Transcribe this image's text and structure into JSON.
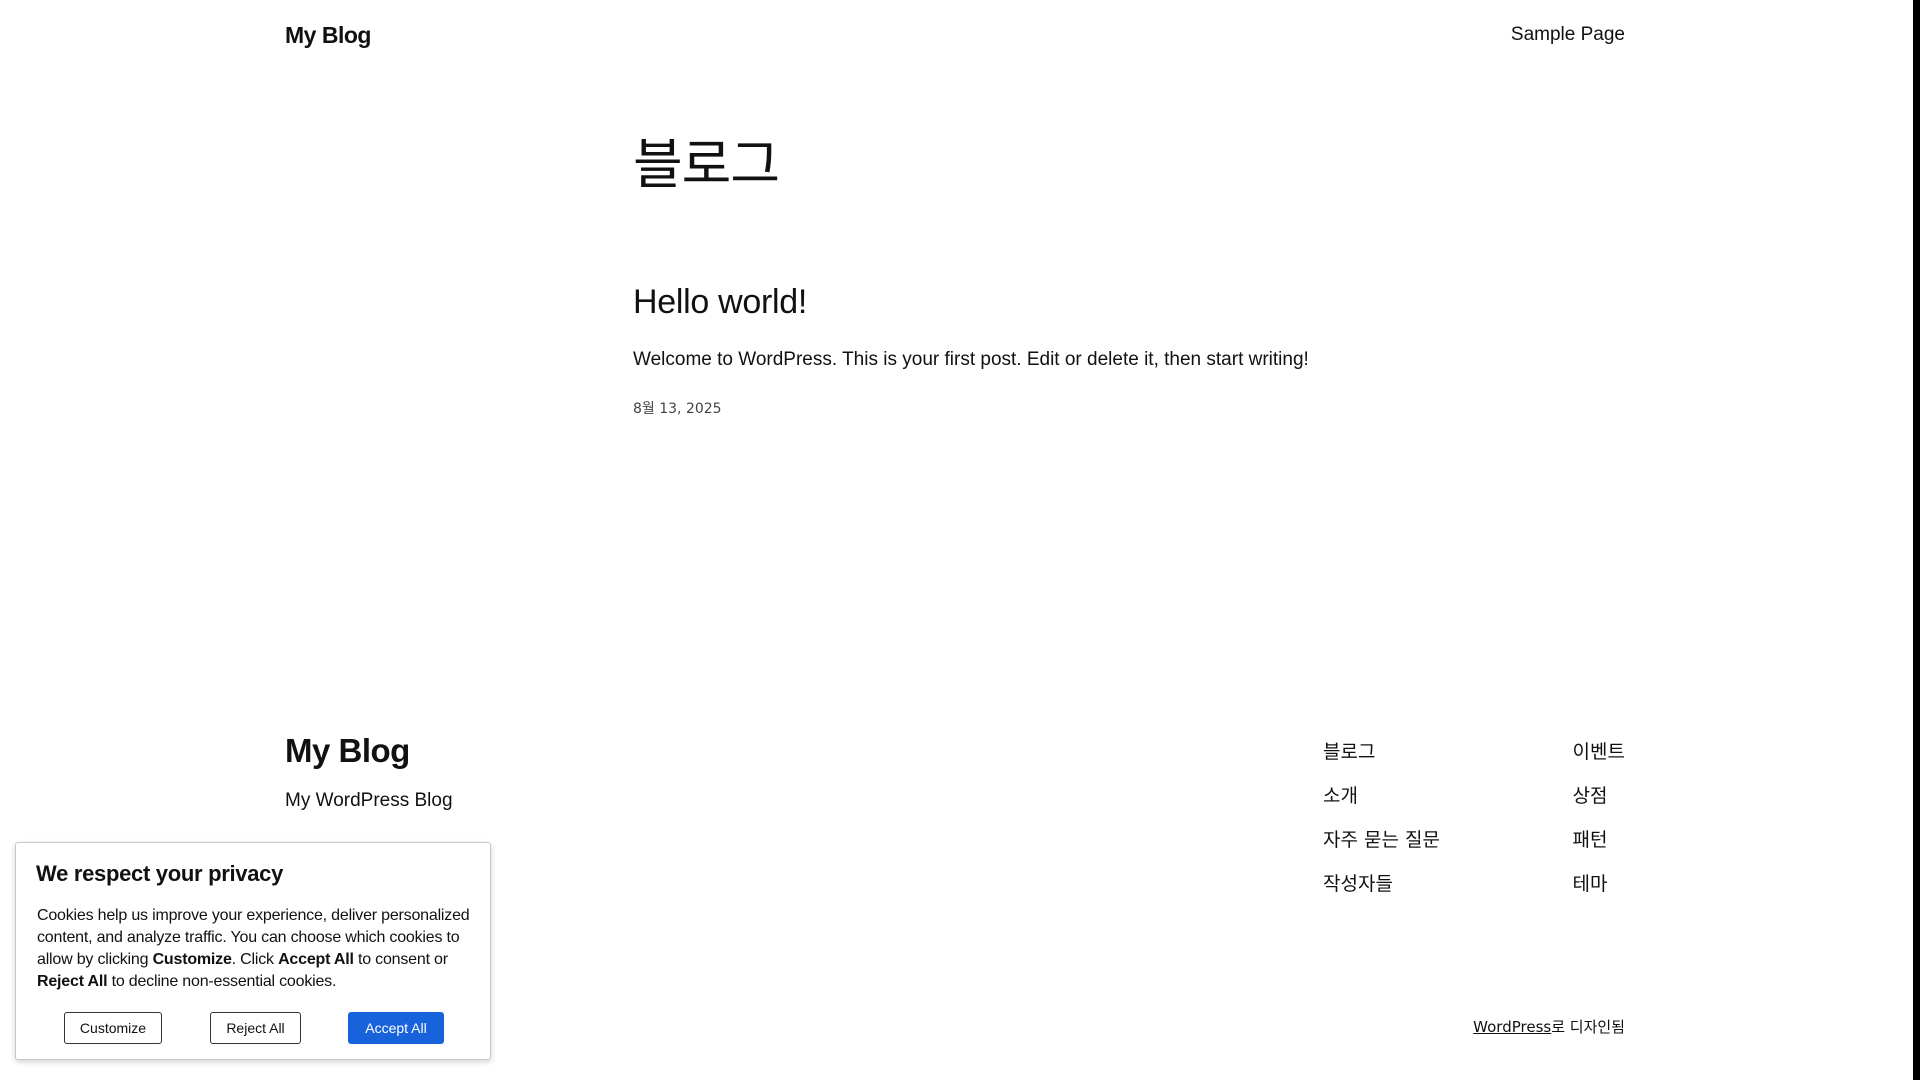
{
  "header": {
    "site_title": "My Blog",
    "nav_items": [
      "Sample Page"
    ]
  },
  "main": {
    "page_title": "블로그",
    "posts": [
      {
        "title": "Hello world!",
        "excerpt": "Welcome to WordPress. This is your first post. Edit or delete it, then start writing!",
        "date": "8월 13, 2025"
      }
    ]
  },
  "footer": {
    "site_title": "My Blog",
    "tagline": "My WordPress Blog",
    "nav_col1": [
      "블로그",
      "소개",
      "자주 묻는 질문",
      "작성자들"
    ],
    "nav_col2": [
      "이벤트",
      "상점",
      "패턴",
      "테마"
    ],
    "credit_link": "WordPress",
    "credit_suffix": "로 디자인됨"
  },
  "cookie_banner": {
    "title": "We respect your privacy",
    "text_1": "Cookies help us improve your experience, deliver personalized content, and analyze traffic. You can choose which cookies to allow by clicking ",
    "bold_customize": "Customize",
    "text_2": ". Click ",
    "bold_accept": "Accept All",
    "text_3": " to consent or ",
    "bold_reject": "Reject All",
    "text_4": " to decline non-essential cookies.",
    "customize_label": "Customize",
    "reject_label": "Reject All",
    "accept_label": "Accept All",
    "accent_color": "#1863dc"
  }
}
